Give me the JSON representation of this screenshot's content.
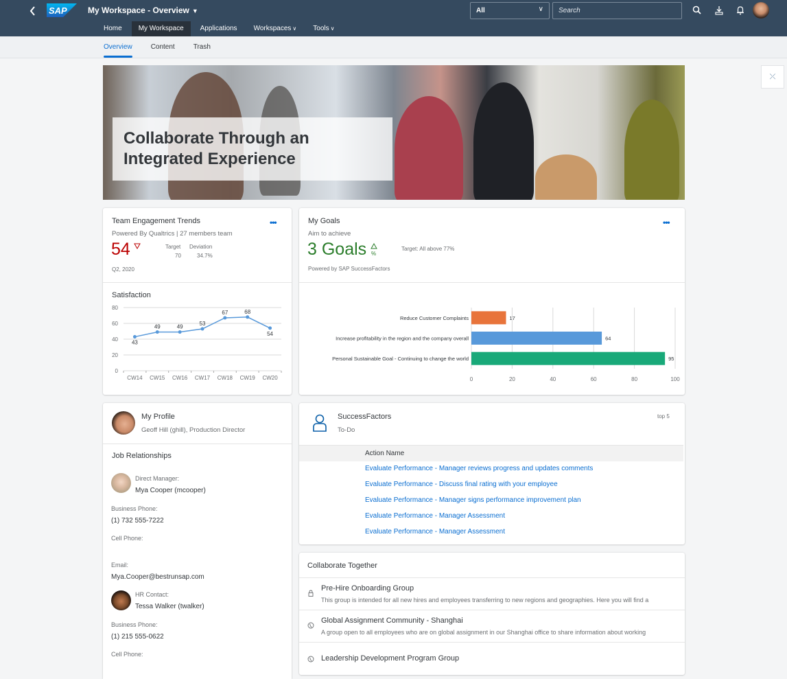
{
  "shell": {
    "title": "My Workspace - Overview",
    "nav": [
      {
        "label": "Home",
        "active": false
      },
      {
        "label": "My Workspace",
        "active": true
      },
      {
        "label": "Applications",
        "active": false
      },
      {
        "label": "Workspaces",
        "active": false,
        "dropdown": true
      },
      {
        "label": "Tools",
        "active": false,
        "dropdown": true
      }
    ],
    "scope_value": "All",
    "search_placeholder": "Search",
    "icons": [
      "back-icon",
      "sap-logo",
      "search-icon",
      "download-icon",
      "bell-icon",
      "user-avatar"
    ]
  },
  "tabs": [
    {
      "label": "Overview",
      "active": true
    },
    {
      "label": "Content",
      "active": false
    },
    {
      "label": "Trash",
      "active": false
    }
  ],
  "hero": {
    "headline": "Collaborate Through an Integrated Experience"
  },
  "engagement": {
    "title": "Team Engagement Trends",
    "subtitle_source": "Powered By Qualtrics",
    "subtitle_team": "27 members team",
    "value": "54",
    "trend": "down",
    "target_label": "Target",
    "target_value": "70",
    "deviation_label": "Deviation",
    "deviation_value": "34.7%",
    "period": "Q2, 2020",
    "value_color": "#bb0000"
  },
  "goals": {
    "title": "My Goals",
    "subtitle": "Aim to achieve",
    "value": "3 Goals",
    "unit": "%",
    "trend": "up",
    "target": "Target: All above 77%",
    "footer": "Powered by SAP SuccessFactors",
    "value_color": "#2b7d2b"
  },
  "chart_data": [
    {
      "type": "line",
      "title": "Satisfaction",
      "categories": [
        "CW14",
        "CW15",
        "CW16",
        "CW17",
        "CW18",
        "CW19",
        "CW20"
      ],
      "values": [
        43,
        49,
        49,
        53,
        67,
        68,
        54
      ],
      "yticks": [
        0,
        20,
        40,
        60,
        80
      ],
      "ylim": [
        0,
        80
      ],
      "grid": true,
      "color": "#5899da"
    },
    {
      "type": "bar",
      "orientation": "horizontal",
      "categories": [
        "Reduce Customer Complaints",
        "Increase profitability in the region and the company overall",
        "Personal Sustainable Goal - Continuing to change the world"
      ],
      "values": [
        17,
        64,
        95
      ],
      "colors": [
        "#e8743b",
        "#5899da",
        "#19a979"
      ],
      "xticks": [
        0,
        20,
        40,
        60,
        80,
        100
      ],
      "xlim": [
        0,
        100
      ],
      "grid": true
    }
  ],
  "profile": {
    "title": "My Profile",
    "subtitle": "Geoff Hill (ghill), Production Director",
    "section": "Job Relationships",
    "manager_label": "Direct Manager:",
    "manager_name": "Mya Cooper (mcooper)",
    "business_phone_label": "Business Phone:",
    "manager_phone": "(1) 732 555-7222",
    "cell_label": "Cell Phone:",
    "email_label": "Email:",
    "manager_email": "Mya.Cooper@bestrunsap.com",
    "hr_label": "HR Contact:",
    "hr_name": "Tessa Walker (twalker)",
    "hr_phone": "(1) 215 555-0622"
  },
  "todo": {
    "title": "SuccessFactors",
    "subtitle": "To-Do",
    "badge": "top 5",
    "column": "Action Name",
    "rows": [
      "Evaluate Performance - Manager reviews progress and updates comments",
      "Evaluate Performance - Discuss final rating with your employee",
      "Evaluate Performance - Manager signs performance improvement plan",
      "Evaluate Performance - Manager Assessment",
      "Evaluate Performance - Manager Assessment"
    ]
  },
  "collab": {
    "title": "Collaborate Together",
    "groups": [
      {
        "title": "Pre-Hire Onboarding Group",
        "desc": "This group is intended for all new hires and employees transferring to new regions and geographies. Here you will find a",
        "icon": "lock-icon"
      },
      {
        "title": "Global Assignment Community - Shanghai",
        "desc": "A group open to all employees who are on global assignment in our Shanghai office to share information about working",
        "icon": "globe-icon"
      },
      {
        "title": "Leadership Development Program Group",
        "desc": "",
        "icon": "globe-icon"
      }
    ]
  }
}
